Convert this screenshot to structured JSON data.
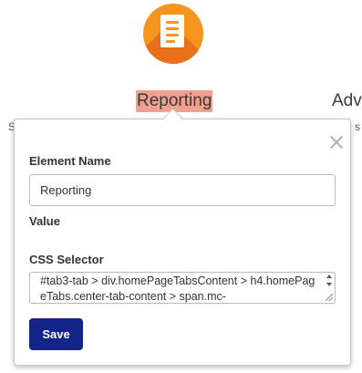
{
  "background": {
    "icon": "document-icon",
    "icon_color": "#f7941d",
    "tabs": [
      {
        "label": "Reporting",
        "highlighted": true,
        "highlight_color": "#f0a090"
      },
      {
        "label": "Adv"
      }
    ],
    "edge_text_left": "S",
    "edge_text_right": "s"
  },
  "popover": {
    "close_icon": "close-icon",
    "element_name_label": "Element Name",
    "element_name_value": "Reporting",
    "value_label": "Value",
    "css_selector_label": "CSS Selector",
    "css_selector_value": "#tab3-tab > div.homePageTabsContent > h4.homePageTabs.center-tab-content > span.mc-",
    "save_label": "Save",
    "save_color": "#13238a"
  }
}
